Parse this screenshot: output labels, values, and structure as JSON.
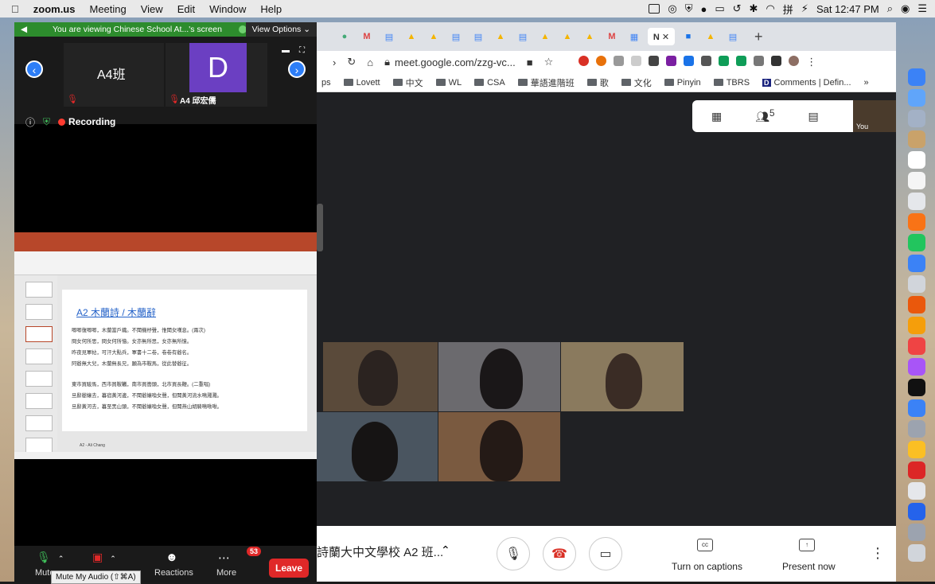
{
  "menubar": {
    "app": "zoom.us",
    "items": [
      "Meeting",
      "View",
      "Edit",
      "Window",
      "Help"
    ],
    "clock": "Sat 12:47 PM"
  },
  "zoom": {
    "notice": "You are viewing Chinese School At...'s screen",
    "view_options": "View Options ⌄",
    "thumbs": [
      {
        "name": "A4班",
        "label": ""
      },
      {
        "initial": "D",
        "label": "A4 邱宏儒"
      }
    ],
    "recording": "Recording",
    "toolbar": {
      "mute_label": "Mute",
      "tooltip": "Mute My Audio (⇧⌘A)",
      "reactions": "Reactions",
      "more": "More",
      "more_badge": "53",
      "leave": "Leave"
    }
  },
  "slide": {
    "heading": "A2  木蘭詩 / 木蘭辭",
    "stanza1": [
      "唧唧復唧唧，木蘭當戶織。不聞機杼聲，惟聞女嘆息。(兩次)",
      "問女何所思，問女何所憶。女亦無所思，女亦無所憶。",
      "昨夜見軍帖，可汗大點兵，軍書十二卷，卷卷有爺名。",
      "阿爺無大兒，木蘭無長兄，願為市鞍馬，從此替爺征。"
    ],
    "stanza2": [
      "東市買駿馬，西市買鞍韉，南市買轡頭，北市買長鞭。(二重唱)",
      "旦辭爺孃去，暮宿黃河邊，不聞爺孃喚女聲，但聞黃河流水鳴濺濺。",
      "旦辭黃河去，暮至黑山頭，不聞爺孃喚女聲，但聞燕山胡騎鳴啾啾。"
    ],
    "label": "A2 - Ali Chang"
  },
  "chrome": {
    "url": "meet.google.com/zzg-vc...",
    "bookmarks": [
      "Lovett",
      "中文",
      "WL",
      "CSA",
      "華語進階班",
      "歌",
      "文化",
      "Pinyin",
      "TBRS",
      "Comments | Defin..."
    ],
    "bookmark_prefix": "ps",
    "bookmark_more": "»",
    "participant_count": "5",
    "self_label": "You"
  },
  "meet": {
    "meeting_title": "詩蘭大中文學校 A2 班...",
    "captions_label": "Turn on captions",
    "present_label": "Present now"
  },
  "colors": {
    "zoom_green": "#2d8c2d",
    "leave_red": "#e02828",
    "meet_end_red": "#d93025",
    "slide_heading_blue": "#2462c8"
  }
}
